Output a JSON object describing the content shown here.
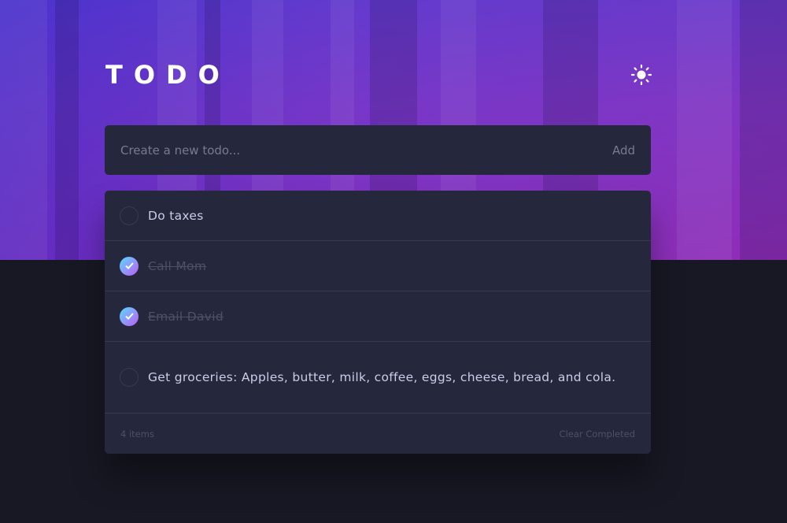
{
  "app": {
    "title": "TODO",
    "theme_icon": "sun-icon"
  },
  "new_todo": {
    "placeholder": "Create a new todo...",
    "value": "",
    "add_label": "Add"
  },
  "todos": [
    {
      "text": "Do taxes",
      "completed": false
    },
    {
      "text": "Call Mom",
      "completed": true
    },
    {
      "text": "Email David",
      "completed": true
    },
    {
      "text": "Get groceries: Apples, butter, milk, coffee, eggs, cheese, bread, and cola.",
      "completed": false
    }
  ],
  "footer": {
    "count_label": "4 items",
    "clear_label": "Clear Completed"
  },
  "colors": {
    "accent_gradient_start": "#57ddff",
    "accent_gradient_end": "#c058f3",
    "card_bg": "#25273c",
    "page_bg": "#181824"
  }
}
